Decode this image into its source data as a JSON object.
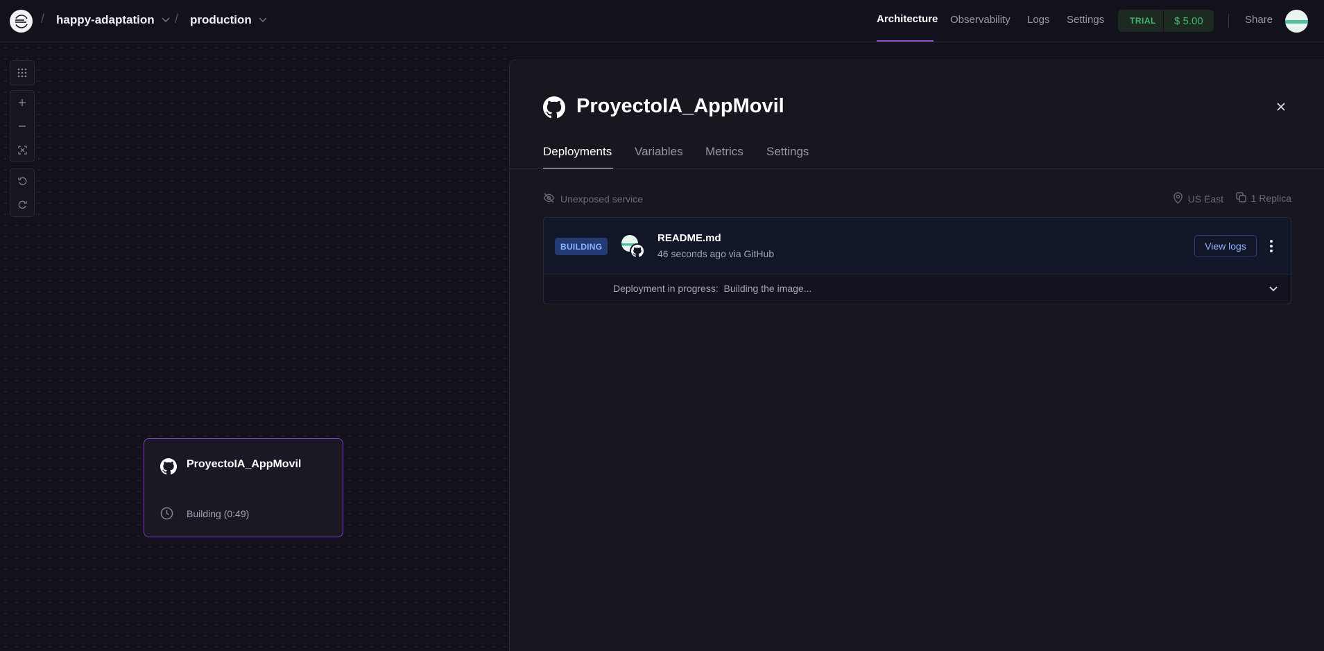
{
  "topbar": {
    "project": "happy-adaptation",
    "environment": "production",
    "nav": [
      "Architecture",
      "Observability",
      "Logs",
      "Settings"
    ],
    "active_nav": "Architecture",
    "trial_label": "TRIAL",
    "trial_amount": "$ 5.00",
    "share_label": "Share"
  },
  "canvas": {
    "service": {
      "name": "ProyectoIA_AppMovil",
      "status": "Building (0:49)"
    }
  },
  "panel": {
    "title": "ProyectoIA_AppMovil",
    "tabs": [
      "Deployments",
      "Variables",
      "Metrics",
      "Settings"
    ],
    "active_tab": "Deployments",
    "exposure": "Unexposed service",
    "region": "US East",
    "replicas": "1 Replica",
    "deployment": {
      "status": "BUILDING",
      "commit_title": "README.md",
      "commit_meta": "46 seconds ago via GitHub",
      "view_logs_label": "View logs",
      "progress": "Deployment in progress:  Building the image..."
    }
  },
  "colors": {
    "background": "#13111c",
    "accent": "#8d4ee0",
    "trial_green": "#3fb970",
    "building_badge": "#233a75"
  },
  "icons": [
    "railway-logo-icon",
    "github-icon",
    "clock-icon",
    "eye-off-icon",
    "map-pin-icon",
    "copy-icon",
    "close-icon",
    "chevron-down-icon",
    "grid-icon",
    "zoom-in-icon",
    "zoom-out-icon",
    "fit-view-icon",
    "undo-icon",
    "redo-icon",
    "more-vertical-icon"
  ]
}
